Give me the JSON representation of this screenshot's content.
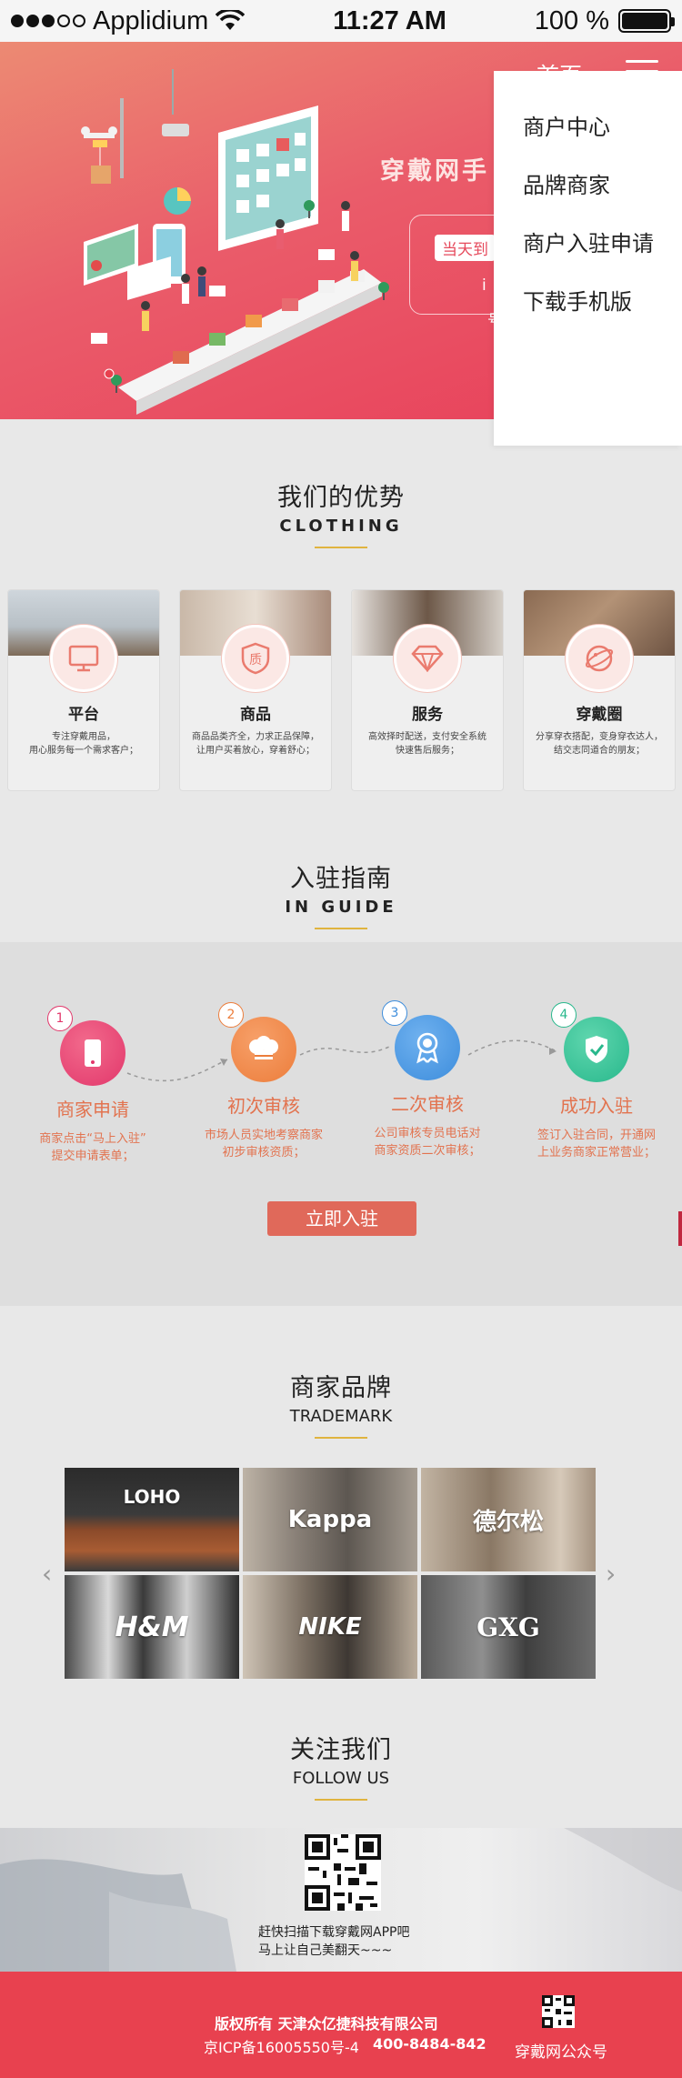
{
  "status_bar": {
    "carrier": "Applidium",
    "time": "11:27 AM",
    "battery": "100 %"
  },
  "hero": {
    "nav_home": "首页",
    "title": "穿戴网手",
    "pill_text": "当天到",
    "small_text_1": "i",
    "small_text_2": "号"
  },
  "dropdown": {
    "items": [
      "商户中心",
      "品牌商家",
      "商户入驻申请",
      "下载手机版"
    ]
  },
  "advantages": {
    "title_cn": "我们的优势",
    "title_en": "CLOTHING",
    "cards": [
      {
        "title": "平台",
        "icon": "monitor-icon",
        "desc": "专注穿戴用品，\n用心服务每一个需求客户；"
      },
      {
        "title": "商品",
        "icon": "quality-shield-icon",
        "desc": "商品品类齐全，力求正品保障，\n让用户买着放心，穿着舒心；"
      },
      {
        "title": "服务",
        "icon": "diamond-icon",
        "desc": "高效择时配送，支付安全系统\n快速售后服务；"
      },
      {
        "title": "穿戴圈",
        "icon": "planet-icon",
        "desc": "分享穿衣搭配，变身穿衣达人，\n结交志同道合的朋友；"
      }
    ]
  },
  "guide": {
    "title_cn": "入驻指南",
    "title_en": "IN GUIDE",
    "steps": [
      {
        "num": "1",
        "title": "商家申请",
        "desc": "商家点击“马上入驻”\n提交申请表单；",
        "icon": "phone-icon",
        "color": "#e2376b"
      },
      {
        "num": "2",
        "title": "初次审核",
        "desc": "市场人员实地考察商家\n初步审核资质；",
        "icon": "chef-hat-icon",
        "color": "#ec7d3b"
      },
      {
        "num": "3",
        "title": "二次审核",
        "desc": "公司审核专员电话对\n商家资质二次审核；",
        "icon": "award-icon",
        "color": "#3d8ddc"
      },
      {
        "num": "4",
        "title": "成功入驻",
        "desc": "签订入驻合同，开通网\n上业务商家正常营业；",
        "icon": "check-shield-icon",
        "color": "#28b88c"
      }
    ],
    "button": "立即入驻"
  },
  "brands": {
    "title_cn": "商家品牌",
    "title_en": "TRADEMARK",
    "items": [
      "LOHO",
      "Kappa",
      "德尔松",
      "H&M",
      "NIKE",
      "GXG"
    ]
  },
  "follow": {
    "title_cn": "关注我们",
    "title_en": "FOLLOW US",
    "line1": "赶快扫描下载穿戴网APP吧",
    "line2": "马上让自己美翻天~~~"
  },
  "footer": {
    "copyright": "版权所有 天津众亿捷科技有限公司",
    "icp": "京ICP备16005550号-4",
    "phone": "400-8484-842",
    "wechat_label": "穿戴网公众号"
  },
  "colors": {
    "brand_red": "#e8414f",
    "accent_gold": "#e0b43f",
    "step_text": "#e2734f"
  }
}
